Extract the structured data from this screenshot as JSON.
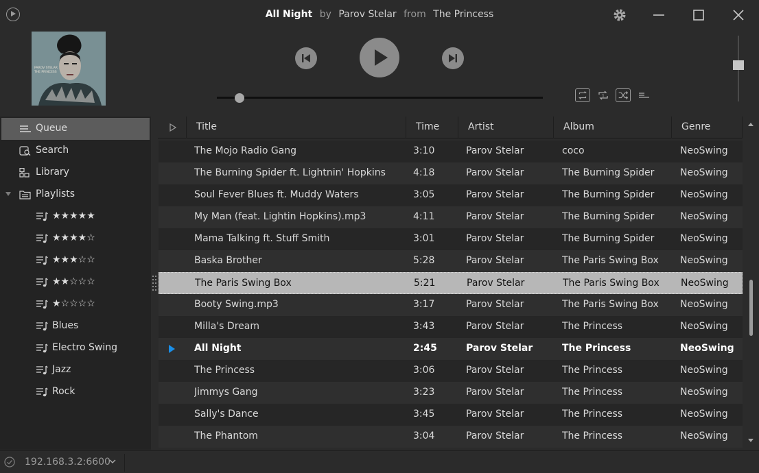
{
  "now_playing": {
    "title": "All Night",
    "by_label": "by",
    "artist": "Parov Stelar",
    "from_label": "from",
    "album": "The Princess"
  },
  "album_art": {
    "cover_text": [
      "PAROV STELAR",
      "THE PRINCESS"
    ]
  },
  "player": {
    "seek_position_fraction": 0.07,
    "volume_fraction": 0.55,
    "icons": {
      "previous": "skip-previous-icon",
      "play": "play-icon",
      "next": "skip-next-icon",
      "repeat": "repeat-icon",
      "repeat_one": "repeat-one-icon",
      "shuffle": "shuffle-icon",
      "queue_mode": "queue-list-icon"
    }
  },
  "window_controls": {
    "icons": [
      "gear-icon",
      "minimize-icon",
      "maximize-icon",
      "close-icon"
    ]
  },
  "sidebar": {
    "items": [
      {
        "label": "Queue",
        "icon": "queue-icon",
        "selected": true
      },
      {
        "label": "Search",
        "icon": "search-icon"
      },
      {
        "label": "Library",
        "icon": "library-icon"
      },
      {
        "label": "Playlists",
        "icon": "playlist-folder-icon",
        "expanded": true
      }
    ],
    "playlists": [
      {
        "label": "★★★★★",
        "icon": "playlist-icon"
      },
      {
        "label": "★★★★☆",
        "icon": "playlist-icon"
      },
      {
        "label": "★★★☆☆",
        "icon": "playlist-icon"
      },
      {
        "label": "★★☆☆☆",
        "icon": "playlist-icon"
      },
      {
        "label": "★☆☆☆☆",
        "icon": "playlist-icon"
      },
      {
        "label": "Blues",
        "icon": "playlist-icon"
      },
      {
        "label": "Electro Swing",
        "icon": "playlist-icon"
      },
      {
        "label": "Jazz",
        "icon": "playlist-icon"
      },
      {
        "label": "Rock",
        "icon": "playlist-icon"
      }
    ]
  },
  "tracklist": {
    "columns": [
      "Title",
      "Time",
      "Artist",
      "Album",
      "Genre"
    ],
    "rows": [
      {
        "title": "The Mojo Radio Gang",
        "time": "3:10",
        "artist": "Parov Stelar",
        "album": "coco",
        "genre": "NeoSwing"
      },
      {
        "title": "The Burning Spider ft. Lightnin' Hopkins",
        "time": "4:18",
        "artist": "Parov Stelar",
        "album": "The Burning Spider",
        "genre": "NeoSwing"
      },
      {
        "title": "Soul Fever Blues ft. Muddy Waters",
        "time": "3:05",
        "artist": "Parov Stelar",
        "album": "The Burning Spider",
        "genre": "NeoSwing"
      },
      {
        "title": "My Man (feat. Lightin Hopkins).mp3",
        "time": "4:11",
        "artist": "Parov Stelar",
        "album": "The Burning Spider",
        "genre": "NeoSwing"
      },
      {
        "title": "Mama Talking ft. Stuff Smith",
        "time": "3:01",
        "artist": "Parov Stelar",
        "album": "The Burning Spider",
        "genre": "NeoSwing"
      },
      {
        "title": "Baska Brother",
        "time": "5:28",
        "artist": "Parov Stelar",
        "album": "The Paris Swing Box",
        "genre": "NeoSwing"
      },
      {
        "title": "The Paris Swing Box",
        "time": "5:21",
        "artist": "Parov Stelar",
        "album": "The Paris Swing Box",
        "genre": "NeoSwing",
        "selected": true
      },
      {
        "title": "Booty Swing.mp3",
        "time": "3:17",
        "artist": "Parov Stelar",
        "album": "The Paris Swing Box",
        "genre": "NeoSwing"
      },
      {
        "title": "Milla's Dream",
        "time": "3:43",
        "artist": "Parov Stelar",
        "album": "The Princess",
        "genre": "NeoSwing"
      },
      {
        "title": "All Night",
        "time": "2:45",
        "artist": "Parov Stelar",
        "album": "The Princess",
        "genre": "NeoSwing",
        "playing": true
      },
      {
        "title": "The Princess",
        "time": "3:06",
        "artist": "Parov Stelar",
        "album": "The Princess",
        "genre": "NeoSwing"
      },
      {
        "title": "Jimmys Gang",
        "time": "3:23",
        "artist": "Parov Stelar",
        "album": "The Princess",
        "genre": "NeoSwing"
      },
      {
        "title": "Sally's Dance",
        "time": "3:45",
        "artist": "Parov Stelar",
        "album": "The Princess",
        "genre": "NeoSwing"
      },
      {
        "title": "The Phantom",
        "time": "3:04",
        "artist": "Parov Stelar",
        "album": "The Princess",
        "genre": "NeoSwing"
      }
    ]
  },
  "status": {
    "server": "192.168.3.2:6600",
    "icons": {
      "connection": "check-circle-icon",
      "server_dropdown": "chevron-down-icon"
    }
  },
  "colors": {
    "background": "#2b2b2b",
    "sidebar": "#232323",
    "selected_nav": "#5c5c5c",
    "selected_row": "#b7b7b7",
    "playing_indicator": "#1a8fe8"
  }
}
